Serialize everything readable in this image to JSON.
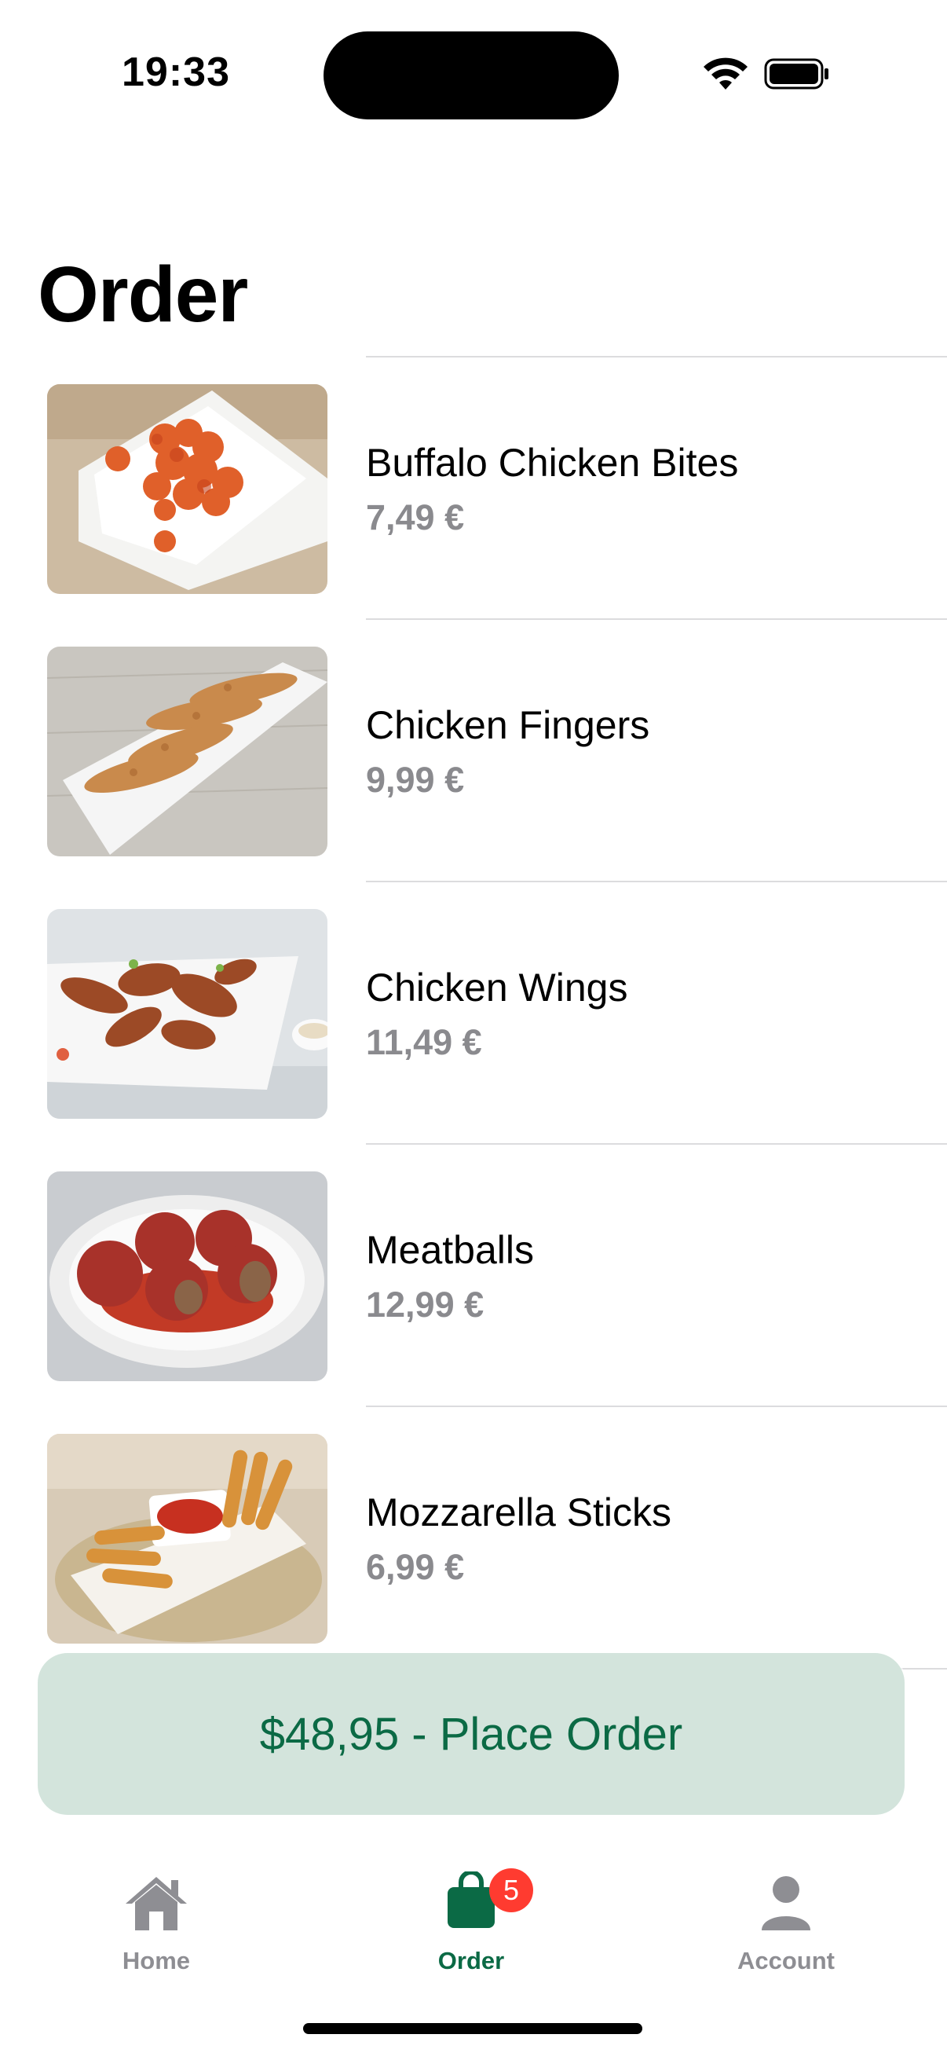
{
  "status_bar": {
    "time": "19:33"
  },
  "page": {
    "title": "Order"
  },
  "items": [
    {
      "name": "Buffalo Chicken Bites",
      "price": "7,49 €"
    },
    {
      "name": "Chicken Fingers",
      "price": "9,99 €"
    },
    {
      "name": "Chicken Wings",
      "price": "11,49 €"
    },
    {
      "name": "Meatballs",
      "price": "12,99 €"
    },
    {
      "name": "Mozzarella Sticks",
      "price": "6,99 €"
    }
  ],
  "place_order": {
    "label": "$48,95 - Place Order"
  },
  "tab_bar": {
    "tabs": [
      {
        "label": "Home",
        "icon": "house-icon"
      },
      {
        "label": "Order",
        "icon": "shopping-bag-icon",
        "badge": "5"
      },
      {
        "label": "Account",
        "icon": "person-icon"
      }
    ],
    "active": "Order"
  },
  "colors": {
    "accent": "#0b6a45",
    "button_bg": "#d3e4dc",
    "badge": "#ff3b30",
    "secondary_text": "#8a8a8e"
  }
}
